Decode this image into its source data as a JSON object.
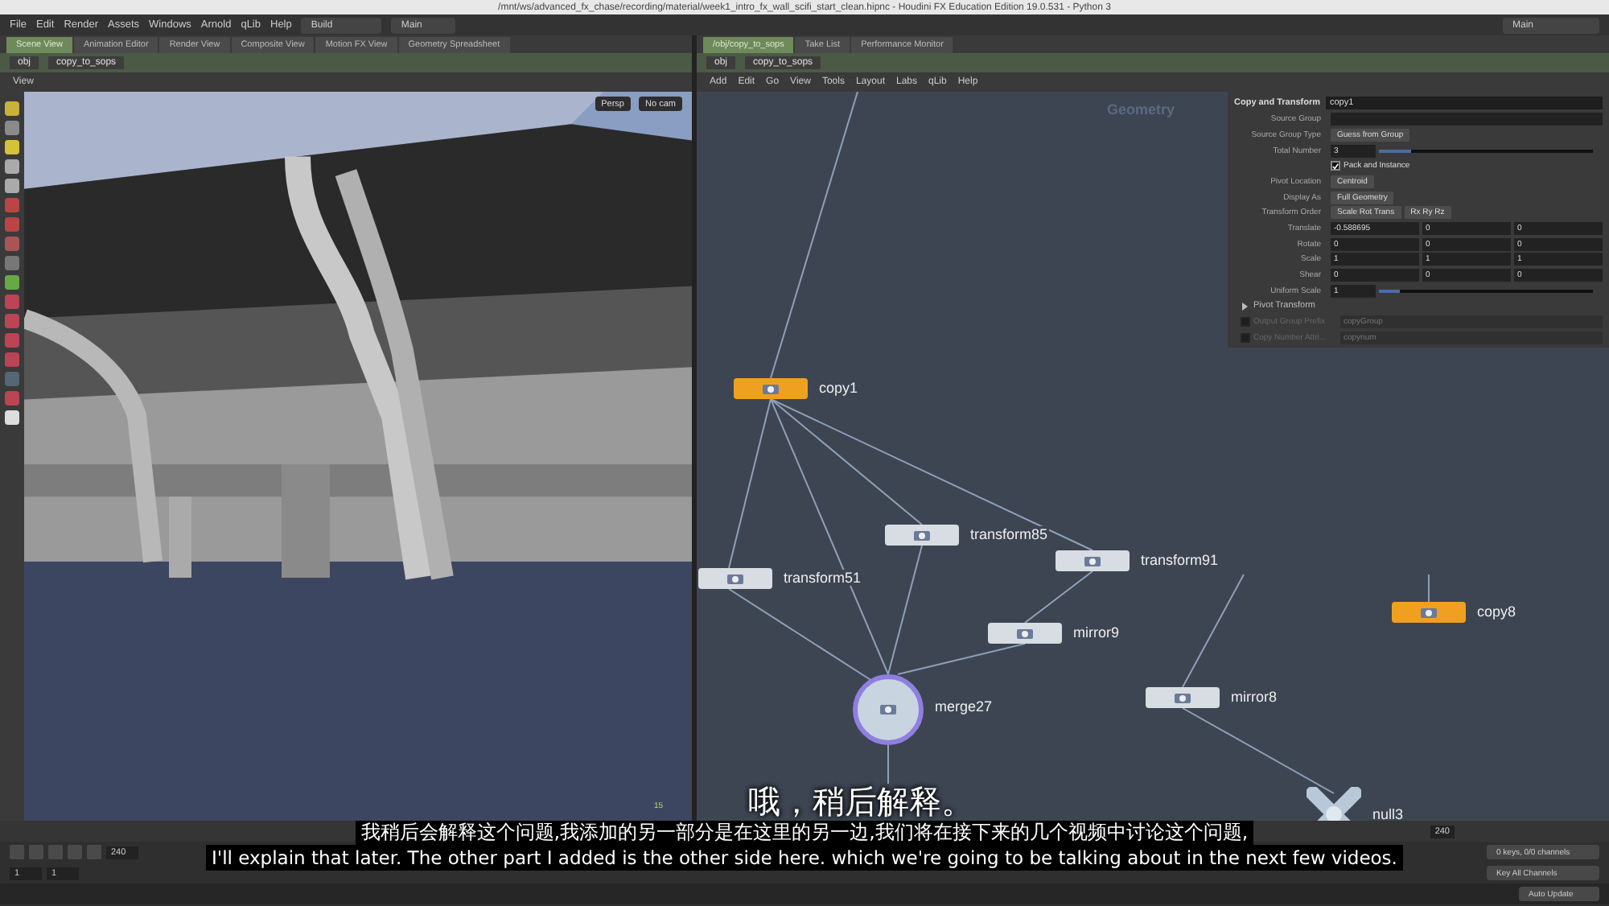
{
  "window": {
    "title": "/mnt/ws/advanced_fx_chase/recording/material/week1_intro_fx_wall_scifi_start_clean.hipnc - Houdini FX Education Edition 19.0.531 - Python 3"
  },
  "menu": [
    "File",
    "Edit",
    "Render",
    "Assets",
    "Windows",
    "Arnold",
    "qLib",
    "Help"
  ],
  "desktops": [
    "Build",
    "Main"
  ],
  "desktop_right": "Main",
  "left_tabs": [
    {
      "label": "Scene View",
      "selected": true
    },
    {
      "label": "Animation Editor",
      "selected": false
    },
    {
      "label": "Render View",
      "selected": false
    },
    {
      "label": "Composite View",
      "selected": false
    },
    {
      "label": "Motion FX View",
      "selected": false
    },
    {
      "label": "Geometry Spreadsheet",
      "selected": false
    }
  ],
  "right_tabs": [
    {
      "label": "/obj/copy_to_sops",
      "selected": true
    },
    {
      "label": "Take List",
      "selected": false
    },
    {
      "label": "Performance Monitor",
      "selected": false
    }
  ],
  "left_path": [
    "obj",
    "copy_to_sops"
  ],
  "right_path": [
    "obj",
    "copy_to_sops"
  ],
  "viewport": {
    "title": "View",
    "camera": "Persp",
    "cam_menu": "No cam",
    "frame_label": "15"
  },
  "network": {
    "menu": [
      "Add",
      "Edit",
      "Go",
      "View",
      "Tools",
      "Layout",
      "Labs",
      "qLib",
      "Help"
    ],
    "context_label": "Geometry",
    "nodes": [
      {
        "name": "copy1",
        "kind": "box",
        "color": "#f0a020"
      },
      {
        "name": "transform85",
        "kind": "box",
        "color": "#d8dde3"
      },
      {
        "name": "transform91",
        "kind": "box",
        "color": "#d8dde3"
      },
      {
        "name": "transform51",
        "kind": "box",
        "color": "#d8dde3"
      },
      {
        "name": "mirror9",
        "kind": "box",
        "color": "#d8dde3"
      },
      {
        "name": "merge27",
        "kind": "circle",
        "color": "#c8d4e0"
      },
      {
        "name": "mirror8",
        "kind": "box",
        "color": "#d8dde3"
      },
      {
        "name": "copy8",
        "kind": "box",
        "color": "#f0a020"
      },
      {
        "name": "null3",
        "kind": "cross",
        "color": "#b8c8d8"
      }
    ]
  },
  "parameters": {
    "type_label": "Copy and Transform",
    "node_name": "copy1",
    "rows": [
      {
        "kind": "field",
        "label": "Source Group"
      },
      {
        "kind": "menu",
        "label": "Source Group Type",
        "values": [
          "Guess from Group"
        ]
      },
      {
        "kind": "slider",
        "label": "Total Number",
        "value": "3",
        "level": 0.15
      },
      {
        "kind": "check",
        "label": "Pack and Instance",
        "checked": true,
        "disabled": false
      },
      {
        "kind": "menu",
        "label": "Pivot Location",
        "values": [
          "Centroid"
        ]
      },
      {
        "kind": "menu",
        "label": "Display As",
        "values": [
          "Full Geometry"
        ]
      },
      {
        "kind": "menu",
        "label": "Transform Order",
        "values": [
          "Scale Rot Trans",
          "Rx Ry Rz"
        ]
      },
      {
        "kind": "vector",
        "label": "Translate",
        "values": [
          "-0.588695",
          "0",
          "0"
        ]
      },
      {
        "kind": "vector",
        "label": "Rotate",
        "values": [
          "0",
          "0",
          "0"
        ]
      },
      {
        "kind": "vector",
        "label": "Scale",
        "values": [
          "1",
          "1",
          "1"
        ]
      },
      {
        "kind": "vector",
        "label": "Shear",
        "values": [
          "0",
          "0",
          "0"
        ]
      },
      {
        "kind": "slider",
        "label": "Uniform Scale",
        "value": "1",
        "level": 0.1
      },
      {
        "kind": "folder",
        "label": "Pivot Transform",
        "expanded": false
      },
      {
        "kind": "checkfield",
        "label": "Output Group Prefix",
        "placeholder": "copyGroup",
        "checked": false,
        "disabled": true
      },
      {
        "kind": "checkfield",
        "label": "Copy Number Attri...",
        "placeholder": "copynum",
        "checked": false,
        "disabled": true
      }
    ]
  },
  "playbar": {
    "end_frame": "240",
    "start_frames": [
      "1",
      "1"
    ],
    "key_info": "0 keys, 0/0 channels",
    "key_button": "Key All Channels",
    "update_menu": "Auto Update",
    "end_marker": "240"
  },
  "subtitles": {
    "title": "哦，稍后解释。",
    "chinese": "我稍后会解释这个问题,我添加的另一部分是在这里的另一边,我们将在接下来的几个视频中讨论这个问题,",
    "english": "I'll explain that later. The other part I added is the other side here. which we're going to be talking about in the next few videos."
  }
}
